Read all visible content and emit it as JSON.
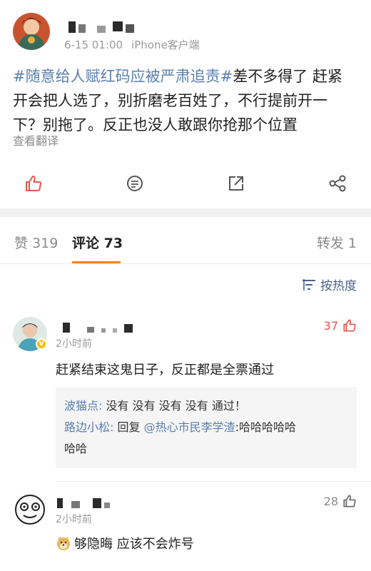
{
  "post": {
    "meta_date": "6-15 01:00",
    "meta_source": "iPhone客户端",
    "hashtag": "#随意给人赋红码应被严肃追责#",
    "body_line1_rest": "差不多得了 赶紧",
    "body_line2": "开会把人选了，别折磨老百姓了，不行提前开一",
    "body_line3": "下？别拖了。反正也没人敢跟你抢那个位置",
    "translate_label": "查看翻译",
    "action_icons": [
      "thumbs-up-icon",
      "comment-icon",
      "share-icon",
      "more-share-icon"
    ]
  },
  "tabs": {
    "likes_label": "赞",
    "likes_count": "319",
    "comments_label": "评论",
    "comments_count": "73",
    "reposts_label": "转发",
    "reposts_count": "1"
  },
  "sort": {
    "label": "按热度"
  },
  "comments": [
    {
      "time": "2小时前",
      "likes": "37",
      "text": "赶紧结束这鬼日子，反正都是全票通过",
      "replies": [
        {
          "author": "波猫点:",
          "text": "没有 没有 没有 没有 通过！"
        },
        {
          "author": "路边小松:",
          "text_prefix": "回复",
          "mention": "@热心市民李学渣",
          "text": ":哈哈哈哈哈",
          "text_line2": "哈哈"
        }
      ]
    },
    {
      "time": "2小时前",
      "likes": "28",
      "text": "够隐晦 应该不会炸号"
    }
  ],
  "colors": {
    "accent_orange": "#ff8200",
    "link_blue": "#5b7fae",
    "like_red": "#e8564a"
  }
}
